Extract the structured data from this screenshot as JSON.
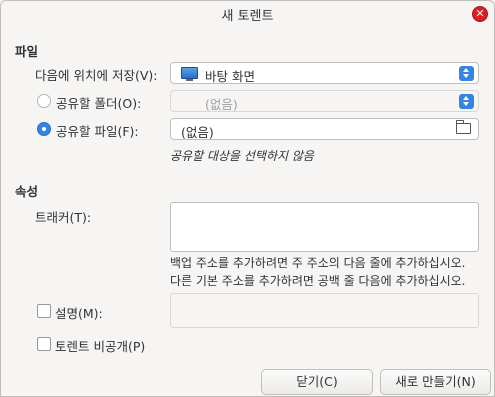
{
  "window": {
    "title": "새 토렌트"
  },
  "file_section": {
    "heading": "파일",
    "save_to": {
      "label": "다음에 위치에 저장(V):",
      "value": "바탕 화면"
    },
    "share_folder": {
      "label": "공유할 폴더(O):",
      "value": "(없음)",
      "selected": false
    },
    "share_file": {
      "label": "공유할 파일(F):",
      "value": "(없음)",
      "selected": true
    },
    "hint": "공유할 대상을 선택하지 않음"
  },
  "properties_section": {
    "heading": "속성",
    "trackers": {
      "label": "트래커(T):",
      "note_line1": "백업 주소를 추가하려면 주 주소의 다음 줄에 추가하십시오.",
      "note_line2": "다른 기본 주소를 추가하려면 공백 줄 다음에 추가하십시오."
    },
    "comment": {
      "label": "설명(M):",
      "checked": false
    },
    "private": {
      "label": "토렌트 비공개(P)",
      "checked": false
    }
  },
  "buttons": {
    "close": "닫기(C)",
    "create": "새로 만들기(N)"
  },
  "colors": {
    "accent": "#3584e4",
    "close": "#e01b24"
  },
  "icons": [
    "close-icon",
    "desktop-icon",
    "chevron-updown-icon",
    "folder-icon"
  ]
}
